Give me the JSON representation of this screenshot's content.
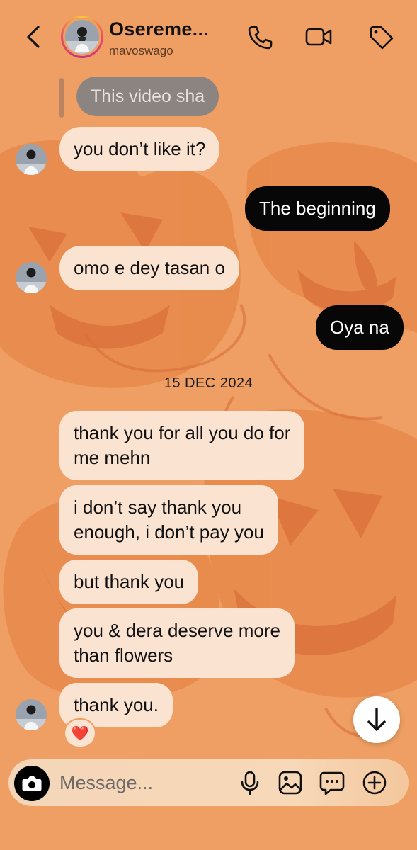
{
  "header": {
    "display_name": "Osereme...",
    "username": "mavoswago",
    "icons": [
      "back-icon",
      "phone-icon",
      "video-icon",
      "tag-icon"
    ]
  },
  "messages": {
    "reply_quote": "This video sha",
    "m1": "you don’t like it?",
    "m2": "The beginning",
    "m3": "omo e dey tasan o",
    "m4": "Oya na",
    "date_divider": "15 DEC 2024",
    "m5_line1": "thank you for all you do for",
    "m5_line2": "me mehn",
    "m6_line1": "i don’t say thank you",
    "m6_line2": "enough, i don’t pay you",
    "m7": "but thank you",
    "m8_line1": "you & dera deserve more",
    "m8_line2": "than flowers",
    "m9": "thank you.",
    "reaction": "❤️"
  },
  "composer": {
    "placeholder": "Message...",
    "icons": [
      "camera-icon",
      "microphone-icon",
      "gallery-icon",
      "sticker-icon",
      "plus-icon"
    ]
  },
  "colors": {
    "background": "#ef9f63",
    "incoming_bubble": "#fbe3d2",
    "outgoing_bubble": "#070707"
  }
}
